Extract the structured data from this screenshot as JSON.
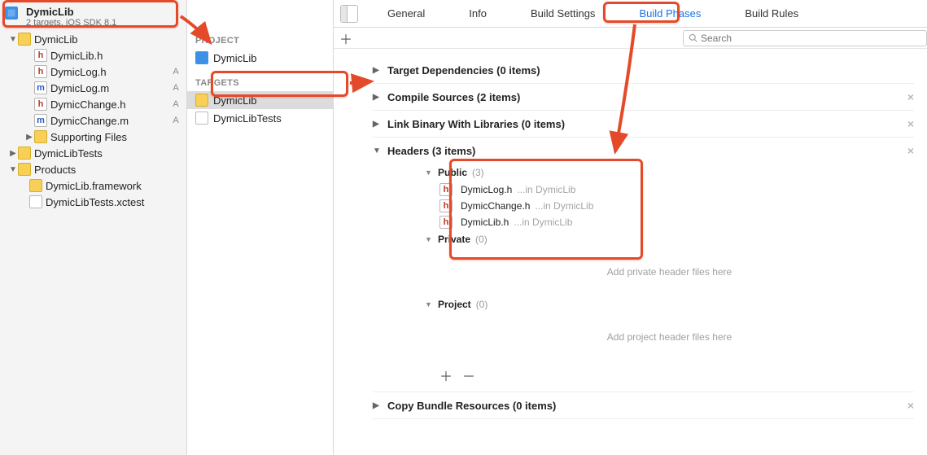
{
  "project": {
    "name": "DymicLib",
    "subtitle": "2 targets, iOS SDK 8.1"
  },
  "navigator": {
    "rootFolder": "DymicLib",
    "files": [
      {
        "name": "DymicLib.h",
        "kind": "h",
        "status": ""
      },
      {
        "name": "DymicLog.h",
        "kind": "h",
        "status": "A"
      },
      {
        "name": "DymicLog.m",
        "kind": "m",
        "status": "A"
      },
      {
        "name": "DymicChange.h",
        "kind": "h",
        "status": "A"
      },
      {
        "name": "DymicChange.m",
        "kind": "m",
        "status": "A"
      }
    ],
    "supportingFolder": "Supporting Files",
    "testsFolder": "DymicLibTests",
    "productsFolder": "Products",
    "products": [
      {
        "name": "DymicLib.framework",
        "kind": "framework"
      },
      {
        "name": "DymicLibTests.xctest",
        "kind": "xctest"
      }
    ]
  },
  "targetsColumn": {
    "projectHeading": "PROJECT",
    "projectEntry": "DymicLib",
    "targetsHeading": "TARGETS",
    "targets": [
      {
        "name": "DymicLib",
        "selected": true,
        "kind": "app"
      },
      {
        "name": "DymicLibTests",
        "selected": false,
        "kind": "tests"
      }
    ]
  },
  "tabs": {
    "general": "General",
    "info": "Info",
    "buildSettings": "Build Settings",
    "buildPhases": "Build Phases",
    "buildRules": "Build Rules",
    "active": "buildPhases"
  },
  "search": {
    "placeholder": "Search"
  },
  "phases": {
    "targetDeps": {
      "title": "Target Dependencies (0 items)",
      "expanded": false
    },
    "compile": {
      "title": "Compile Sources (2 items)",
      "expanded": false
    },
    "linkBinary": {
      "title": "Link Binary With Libraries (0 items)",
      "expanded": false
    },
    "headers": {
      "title": "Headers (3 items)",
      "expanded": true,
      "public": {
        "label": "Public",
        "count": "(3)",
        "files": [
          {
            "name": "DymicLog.h",
            "loc": "...in DymicLib"
          },
          {
            "name": "DymicChange.h",
            "loc": "...in DymicLib"
          },
          {
            "name": "DymicLib.h",
            "loc": "...in DymicLib"
          }
        ]
      },
      "private": {
        "label": "Private",
        "count": "(0)",
        "placeholder": "Add private header files here"
      },
      "project": {
        "label": "Project",
        "count": "(0)",
        "placeholder": "Add project header files here"
      }
    },
    "copyBundle": {
      "title": "Copy Bundle Resources (0 items)",
      "expanded": false
    }
  },
  "glyphs": {
    "triRight": "▶",
    "triDown": "▼",
    "plus": "＋",
    "minus": "－",
    "close": "×"
  }
}
